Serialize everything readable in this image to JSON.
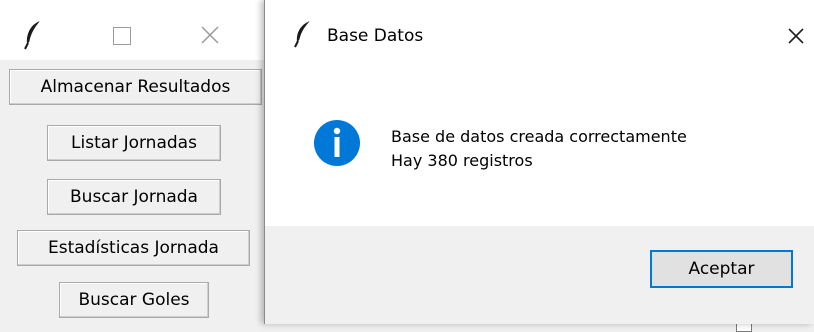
{
  "main_window": {
    "titlebar": {
      "icons": [
        "feather-icon",
        "maximize-icon",
        "close-icon"
      ]
    },
    "buttons": [
      {
        "label": "Almacenar Resultados"
      },
      {
        "label": "Listar Jornadas"
      },
      {
        "label": "Buscar Jornada"
      },
      {
        "label": "Estadísticas Jornada"
      },
      {
        "label": "Buscar Goles"
      }
    ]
  },
  "dialog": {
    "title": "Base Datos",
    "icon": "info-icon",
    "message_line1": "Base de datos creada correctamente",
    "message_line2": "Hay 380 registros",
    "ok_button": "Aceptar"
  },
  "colors": {
    "window_bg": "#f0f0f0",
    "titlebar_bg": "#ffffff",
    "info_blue": "#0078d7",
    "focus_border": "#0078d7"
  }
}
